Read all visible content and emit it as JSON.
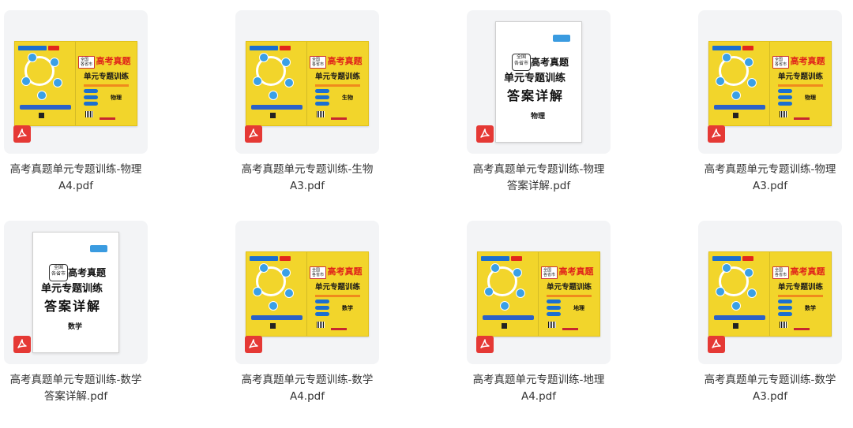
{
  "files": [
    {
      "name": "高考真题单元专题训练-物理A4.pdf",
      "type": "pdf",
      "cover": "spread",
      "subject": "物理"
    },
    {
      "name": "高考真题单元专题训练-生物A3.pdf",
      "type": "pdf",
      "cover": "spread",
      "subject": "生物"
    },
    {
      "name": "高考真题单元专题训练-物理答案详解.pdf",
      "type": "pdf",
      "cover": "booklet",
      "subject": "物理"
    },
    {
      "name": "高考真题单元专题训练-物理A3.pdf",
      "type": "pdf",
      "cover": "spread",
      "subject": "物理"
    },
    {
      "name": "高考真题单元专题训练-数学答案详解.pdf",
      "type": "pdf",
      "cover": "booklet",
      "subject": "数学"
    },
    {
      "name": "高考真题单元专题训练-数学A4.pdf",
      "type": "pdf",
      "cover": "spread",
      "subject": "数学"
    },
    {
      "name": "高考真题单元专题训练-地理A4.pdf",
      "type": "pdf",
      "cover": "spread",
      "subject": "地理"
    },
    {
      "name": "高考真题单元专题训练-数学A3.pdf",
      "type": "pdf",
      "cover": "spread",
      "subject": "数学"
    }
  ],
  "cover_text": {
    "series_label": "全国\n各省市",
    "headline": "高考真题",
    "subtitle": "单元专题训练",
    "answer_title": "答案详解"
  },
  "colors": {
    "tile_bg": "#f3f4f6",
    "cover_yellow": "#f2d52b",
    "pdf_red": "#e53935",
    "title_red": "#e0231a"
  },
  "icon": "pdf-icon"
}
